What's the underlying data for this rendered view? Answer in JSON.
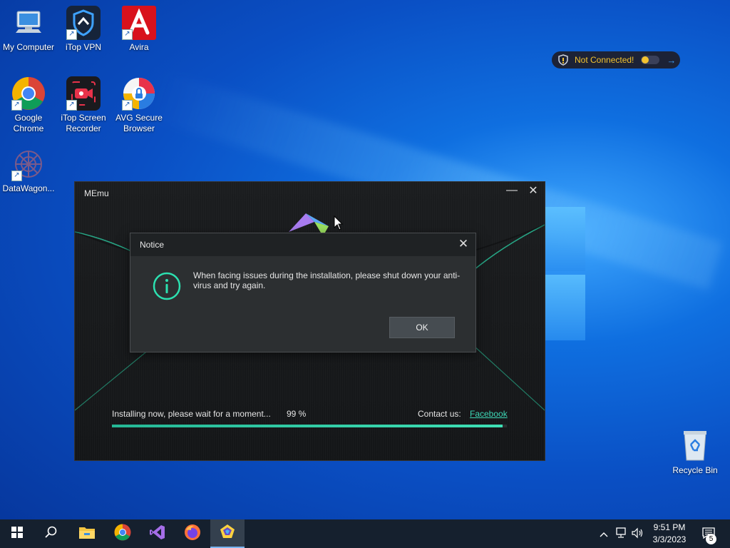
{
  "desktop": {
    "icons": [
      {
        "label": "My Computer"
      },
      {
        "label": "iTop VPN"
      },
      {
        "label": "Avira"
      },
      {
        "label": "Google Chrome"
      },
      {
        "label": "iTop Screen Recorder"
      },
      {
        "label": "AVG Secure Browser"
      },
      {
        "label": "DataWagon..."
      },
      {
        "label": "Recycle Bin"
      }
    ],
    "vpn_widget": {
      "status": "Not Connected!",
      "icon": "vpn-shield-icon",
      "accent": "#f2c230"
    }
  },
  "memu_window": {
    "title": "MEmu",
    "install_status": "Installing now, please wait for a moment...",
    "progress_text": "99 %",
    "progress": 0.99,
    "contact_label": "Contact us:",
    "facebook_link": "Facebook",
    "accent": "#3ee0b5"
  },
  "notice_dialog": {
    "title": "Notice",
    "message": "When facing issues during the installation, please shut down your anti-virus and try again.",
    "ok_label": "OK",
    "icon": "info-icon"
  },
  "taskbar": {
    "items": [
      "windows-start-icon",
      "search-icon",
      "file-explorer-icon",
      "chrome-icon",
      "visual-studio-icon",
      "firefox-icon",
      "memu-icon"
    ],
    "clock_time": "9:51 PM",
    "clock_date": "3/3/2023",
    "notification_count": "5"
  }
}
